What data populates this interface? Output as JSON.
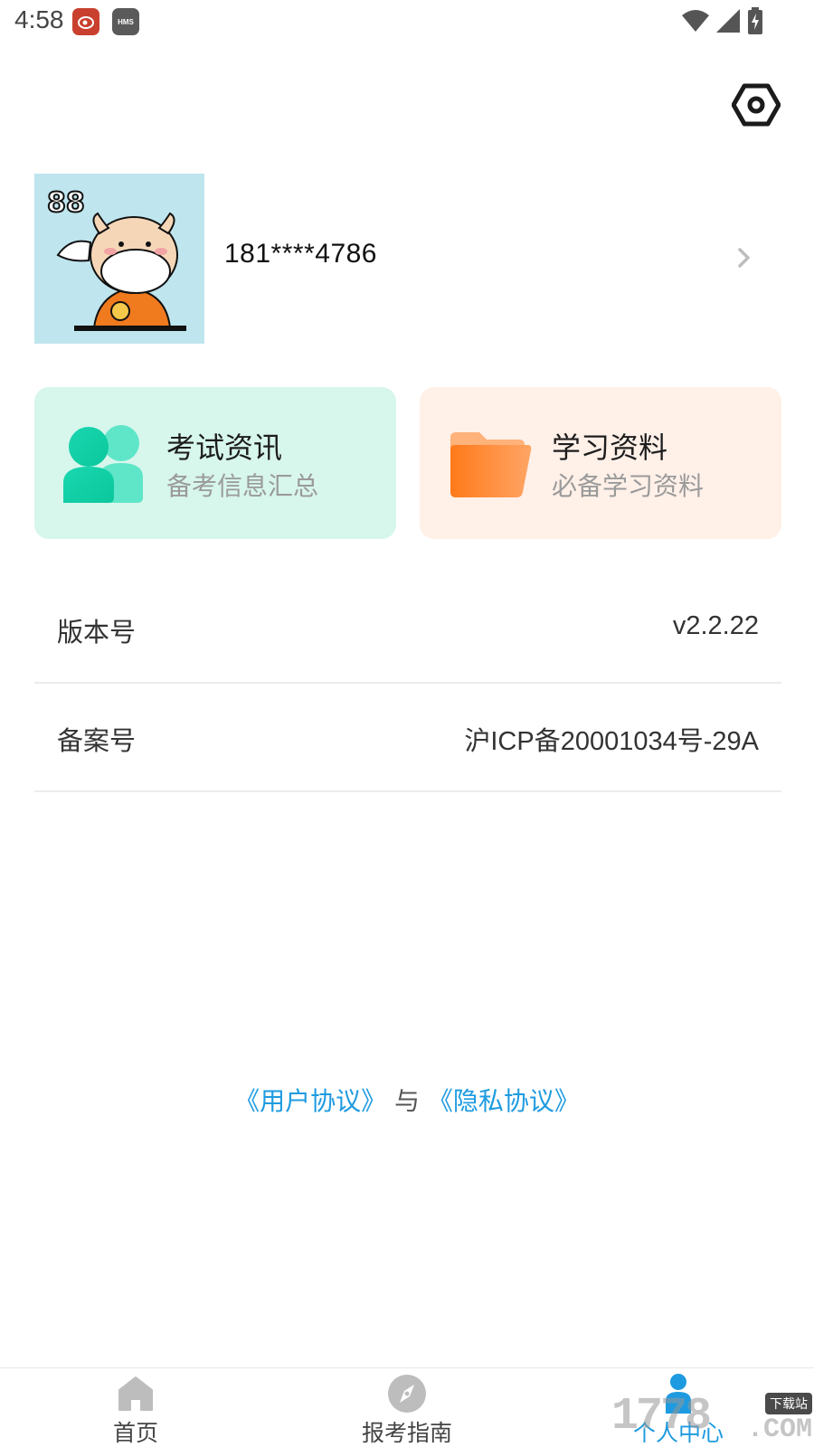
{
  "status_bar": {
    "time": "4:58",
    "badges": [
      "weibo-app-icon",
      "HMS"
    ]
  },
  "profile": {
    "phone": "181****4786"
  },
  "cards": [
    {
      "title": "考试资讯",
      "subtitle": "备考信息汇总",
      "icon": "users-icon",
      "bg": "#d7f6ec"
    },
    {
      "title": "学习资料",
      "subtitle": "必备学习资料",
      "icon": "folder-icon",
      "bg": "#fff0e8"
    }
  ],
  "info": [
    {
      "label": "版本号",
      "value": "v2.2.22"
    },
    {
      "label": "备案号",
      "value": "沪ICP备20001034号-29A"
    }
  ],
  "agreement": {
    "user_agreement": "《用户协议》",
    "joiner": "与",
    "privacy_agreement": "《隐私协议》"
  },
  "bottom_nav": [
    {
      "label": "首页",
      "icon": "home-icon"
    },
    {
      "label": "报考指南",
      "icon": "compass-icon"
    },
    {
      "label": "个人中心",
      "icon": "person-icon",
      "active": true
    }
  ],
  "watermark": {
    "text": "1778",
    "badge": "下载站",
    "suffix": ".COM"
  },
  "colors": {
    "accent": "#1e9be0",
    "exam_card": "#d7f6ec",
    "study_card": "#fff0e8"
  }
}
